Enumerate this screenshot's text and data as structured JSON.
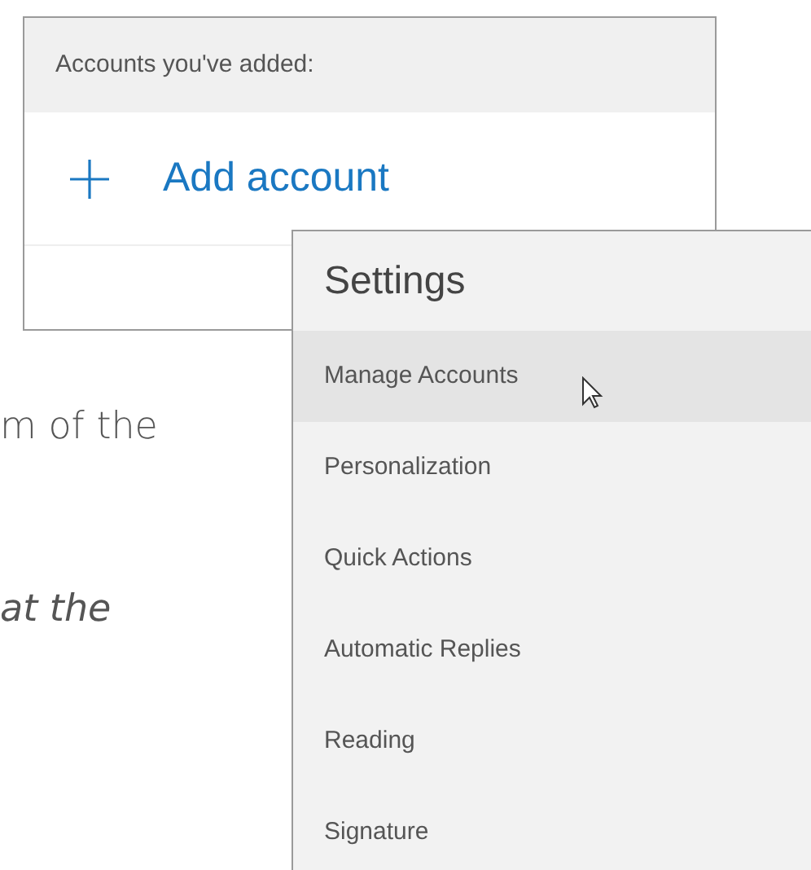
{
  "accounts_panel": {
    "header": "Accounts you've added:",
    "add_button": "Add account"
  },
  "body_text": [
    {
      "text": "m of the",
      "italic": false
    },
    {
      "text": "at the",
      "italic": true
    }
  ],
  "settings": {
    "title": "Settings",
    "items": [
      {
        "label": "Manage Accounts",
        "selected": true
      },
      {
        "label": "Personalization",
        "selected": false
      },
      {
        "label": "Quick Actions",
        "selected": false
      },
      {
        "label": "Automatic Replies",
        "selected": false
      },
      {
        "label": "Reading",
        "selected": false
      },
      {
        "label": "Signature",
        "selected": false
      }
    ]
  }
}
